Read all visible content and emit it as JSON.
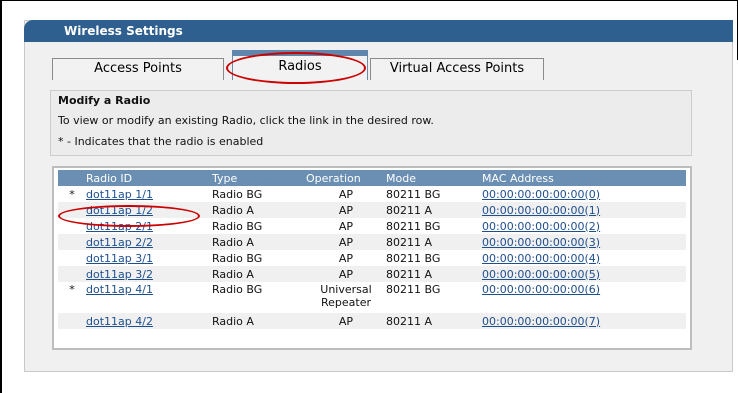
{
  "panel": {
    "title": "Wireless Settings"
  },
  "tabs": [
    {
      "label": "Access Points"
    },
    {
      "label": "Radios"
    },
    {
      "label": "Virtual Access Points"
    }
  ],
  "intro": {
    "title": "Modify a Radio",
    "text": "To view or modify an existing Radio, click the link in the desired row.",
    "note": "* - Indicates that the radio is enabled"
  },
  "table": {
    "headers": [
      "Radio ID",
      "Type",
      "Operation",
      "Mode",
      "MAC Address"
    ],
    "rows": [
      {
        "star": "*",
        "id": "dot11ap 1/1",
        "type": "Radio BG",
        "op": "AP",
        "mode": "80211 BG",
        "mac": "00:00:00:00:00:00(0)"
      },
      {
        "star": "",
        "id": "dot11ap 1/2",
        "type": "Radio A",
        "op": "AP",
        "mode": "80211 A",
        "mac": "00:00:00:00:00:00(1)"
      },
      {
        "star": "",
        "id": "dot11ap 2/1",
        "type": "Radio BG",
        "op": "AP",
        "mode": "80211 BG",
        "mac": "00:00:00:00:00:00(2)"
      },
      {
        "star": "",
        "id": "dot11ap 2/2",
        "type": "Radio A",
        "op": "AP",
        "mode": "80211 A",
        "mac": "00:00:00:00:00:00(3)"
      },
      {
        "star": "",
        "id": "dot11ap 3/1",
        "type": "Radio BG",
        "op": "AP",
        "mode": "80211 BG",
        "mac": "00:00:00:00:00:00(4)"
      },
      {
        "star": "",
        "id": "dot11ap 3/2",
        "type": "Radio A",
        "op": "AP",
        "mode": "80211 A",
        "mac": "00:00:00:00:00:00(5)"
      },
      {
        "star": "*",
        "id": "dot11ap 4/1",
        "type": "Radio BG",
        "op": "Universal Repeater",
        "mode": "80211 BG",
        "mac": "00:00:00:00:00:00(6)"
      },
      {
        "star": "",
        "id": "dot11ap 4/2",
        "type": "Radio A",
        "op": "AP",
        "mode": "80211 A",
        "mac": "00:00:00:00:00:00(7)"
      }
    ]
  }
}
